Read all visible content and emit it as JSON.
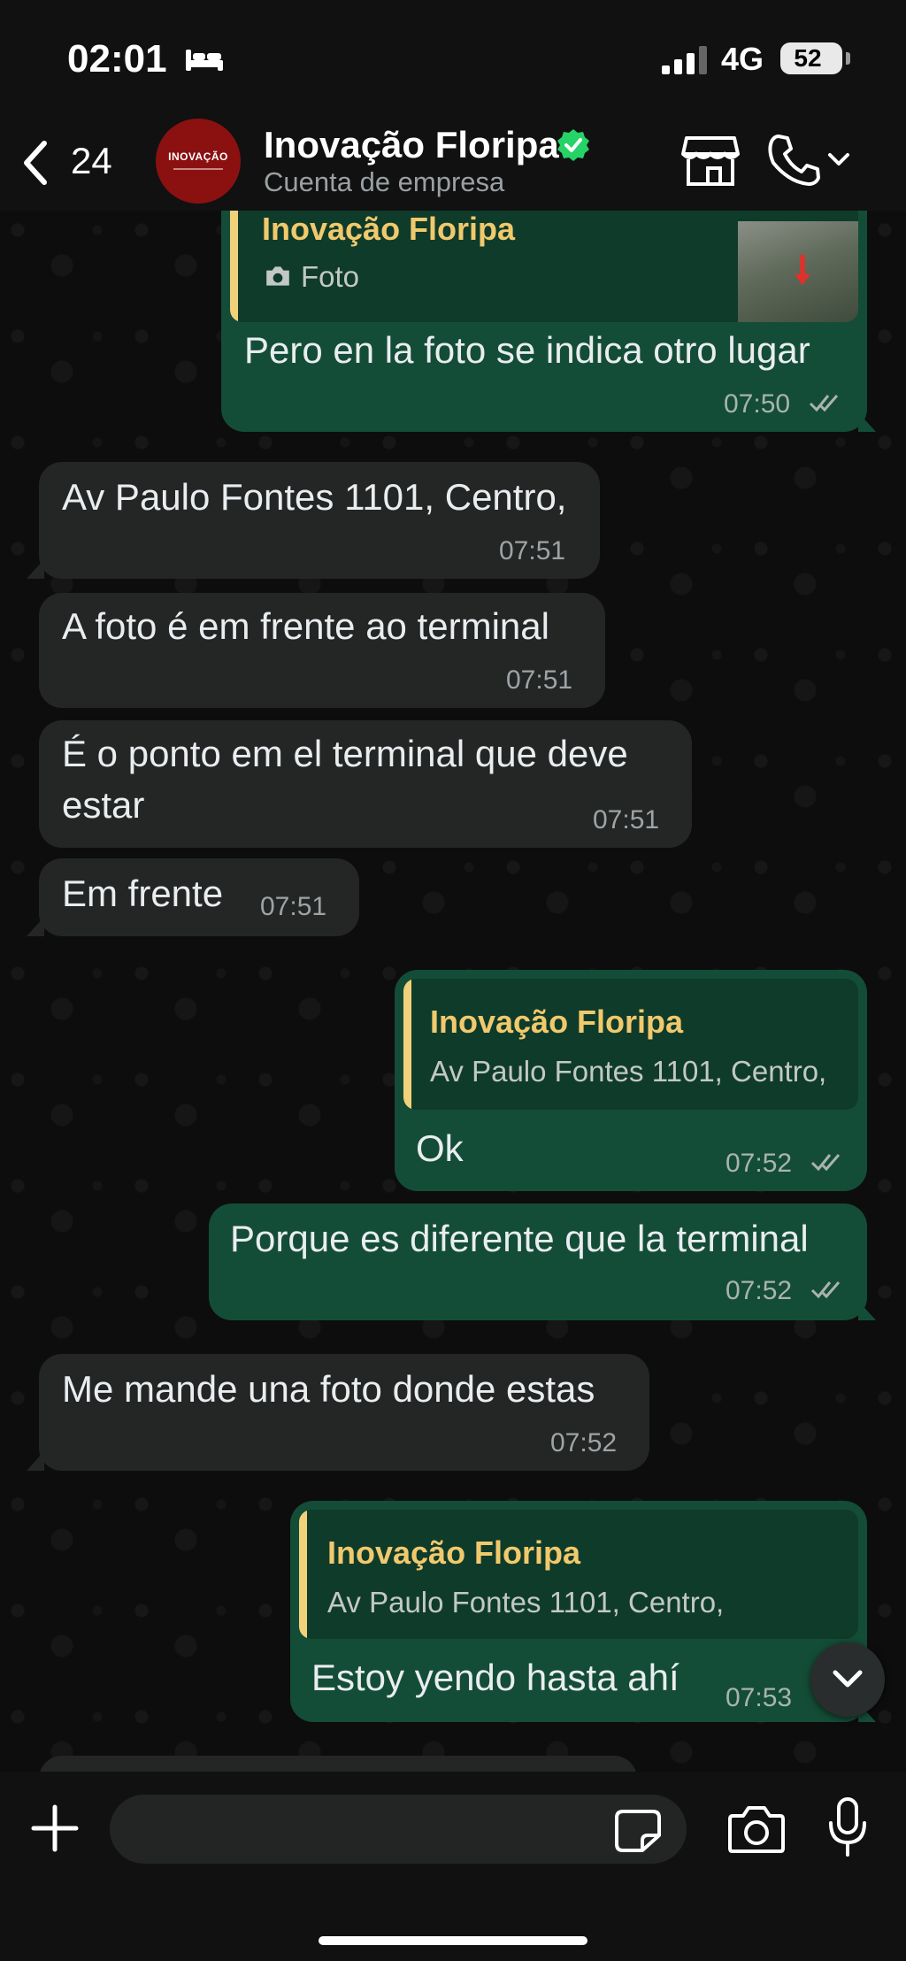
{
  "status_bar": {
    "time": "02:01",
    "network": "4G",
    "battery": "52"
  },
  "header": {
    "back_count": "24",
    "avatar_logo": "INOVAÇÃO",
    "name": "Inovação Floripa",
    "subtitle": "Cuenta de empresa"
  },
  "messages": [
    {
      "dir": "out",
      "quote_name": "Inovação Floripa",
      "quote_text": "Foto",
      "text": "Pero en la foto se indica otro lugar",
      "time": "07:50"
    },
    {
      "dir": "in",
      "text": "Av Paulo Fontes 1101, Centro,",
      "time": "07:51"
    },
    {
      "dir": "in",
      "text": "A foto é em frente ao terminal",
      "time": "07:51"
    },
    {
      "dir": "in",
      "text_line1": "É o ponto em el terminal que deve",
      "text_line2": "estar",
      "time": "07:51"
    },
    {
      "dir": "in",
      "text": "Em frente",
      "time": "07:51"
    },
    {
      "dir": "out",
      "quote_name": "Inovação Floripa",
      "quote_text": "Av Paulo Fontes 1101, Centro,",
      "text": "Ok",
      "time": "07:52"
    },
    {
      "dir": "out",
      "text": "Porque es diferente que la terminal",
      "time": "07:52"
    },
    {
      "dir": "in",
      "text": "Me mande una foto donde estas",
      "time": "07:52"
    },
    {
      "dir": "out",
      "quote_name": "Inovação Floripa",
      "quote_text": "Av Paulo Fontes 1101, Centro,",
      "text": "Estoy yendo hasta ahí",
      "time": "07:53"
    }
  ],
  "composer": {
    "placeholder": ""
  },
  "colors": {
    "incoming_bubble": "#242626",
    "outgoing_bubble": "#144d37",
    "quote_accent": "#f1d27a",
    "verified_badge": "#25d366"
  },
  "icons": [
    "bed-icon",
    "signal-icon",
    "chevron-left-icon",
    "verified-icon",
    "store-icon",
    "phone-icon",
    "chevron-down-icon",
    "camera-icon",
    "double-check-icon",
    "plus-icon",
    "sticker-icon",
    "microphone-icon"
  ]
}
